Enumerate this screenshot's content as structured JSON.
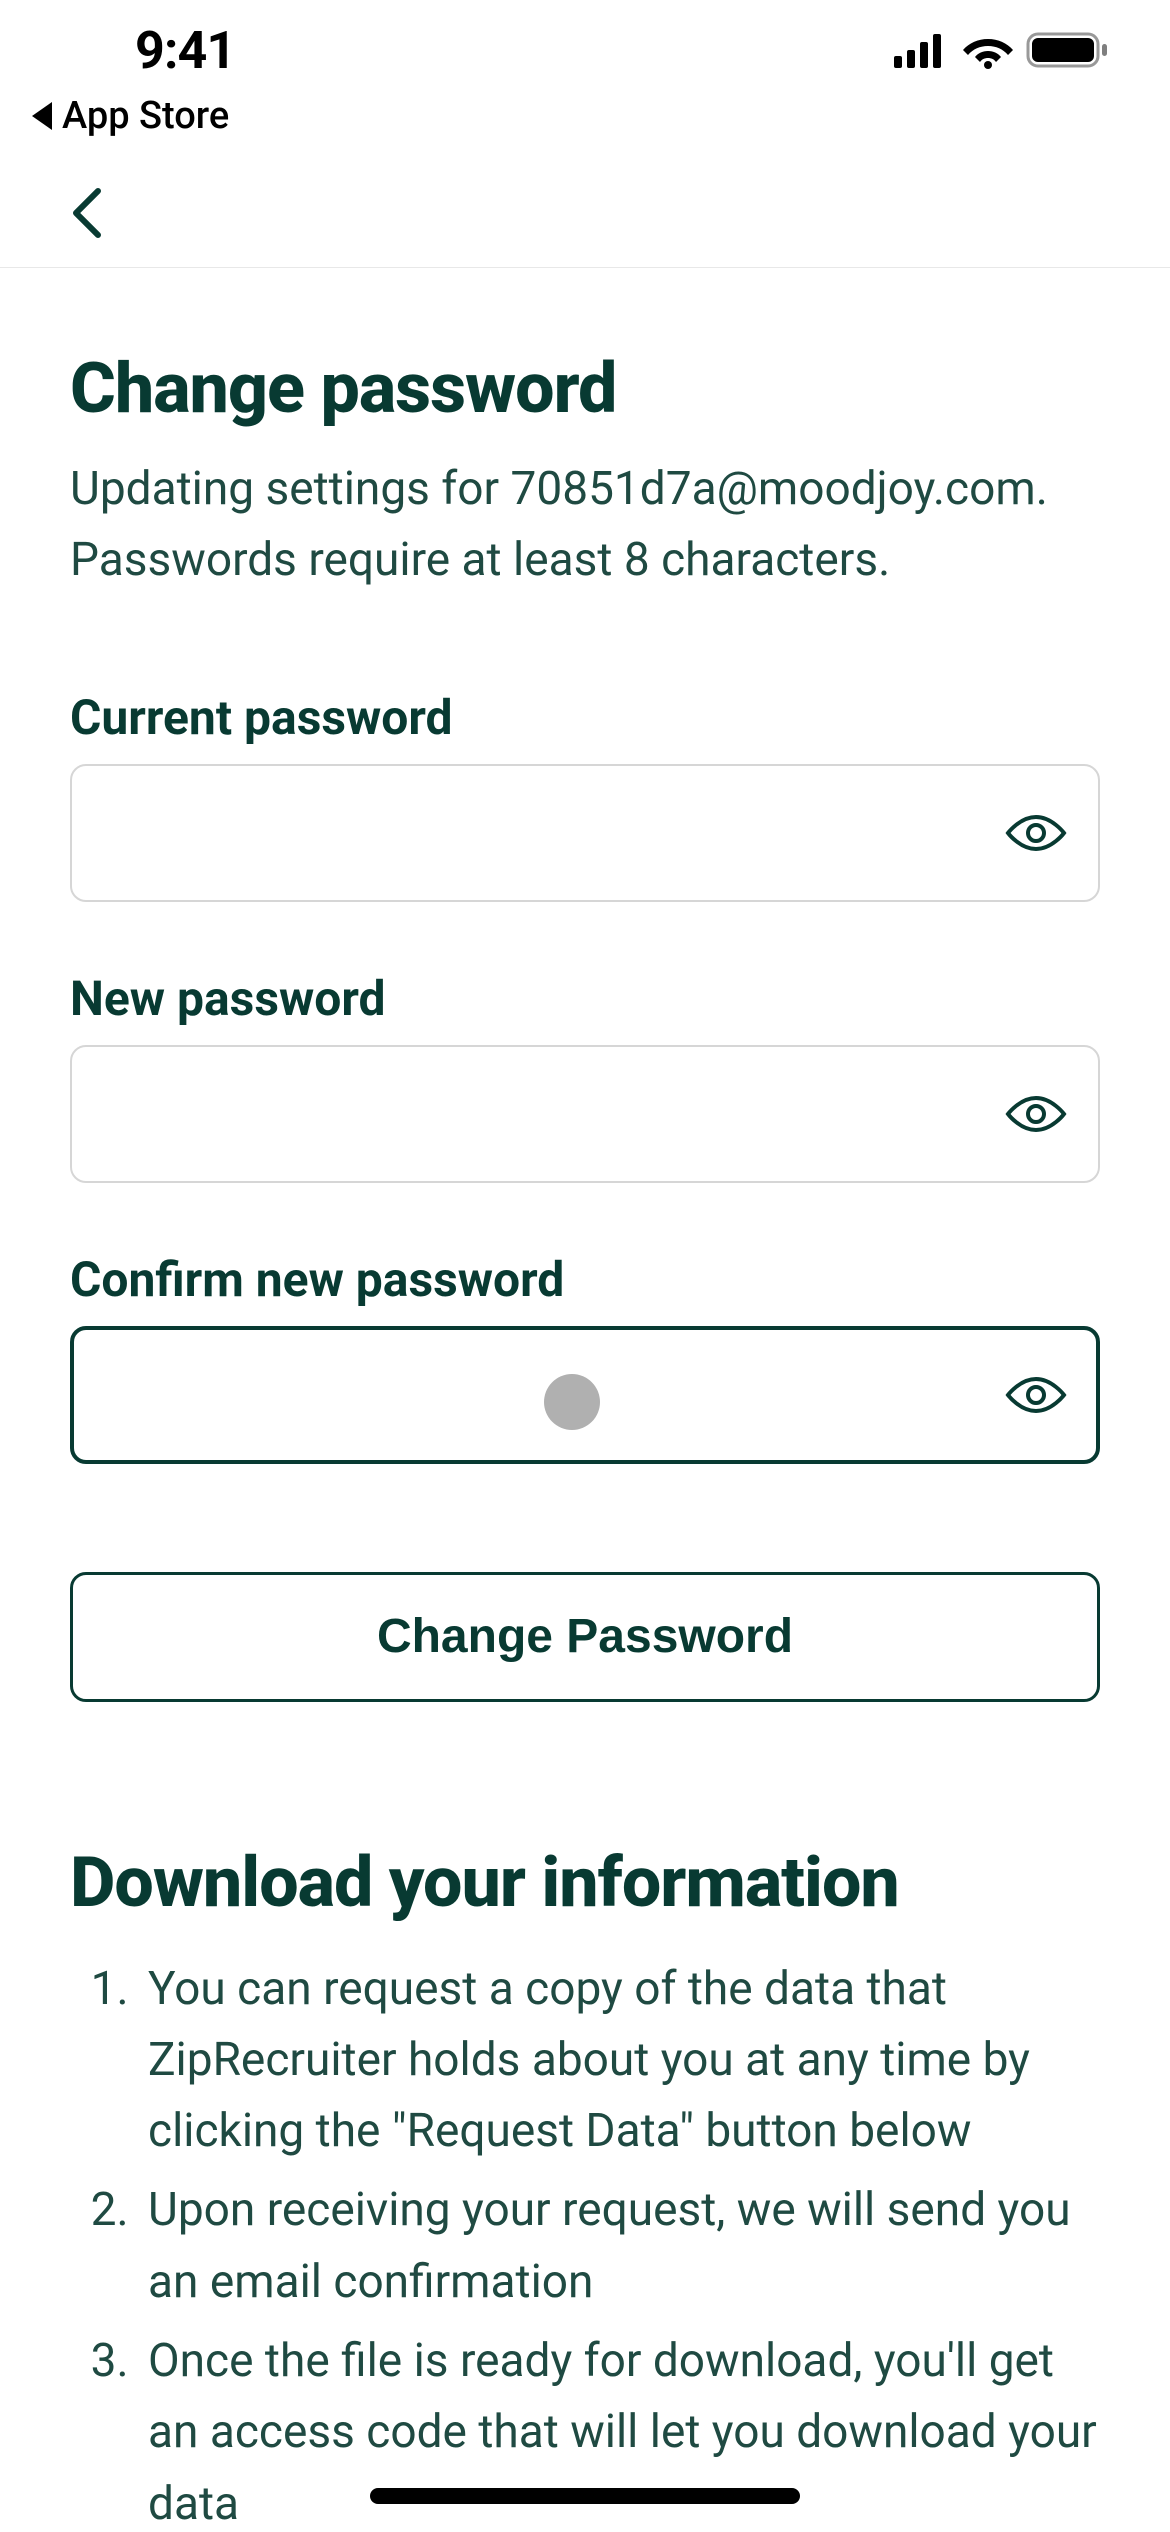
{
  "statusbar": {
    "time": "9:41",
    "back_app_label": "App Store"
  },
  "page": {
    "title": "Change password",
    "subtitle": "Updating settings for 70851d7a@moodjoy.com. Passwords require at least 8 characters."
  },
  "fields": {
    "current": {
      "label": "Current password",
      "value": ""
    },
    "new": {
      "label": "New password",
      "value": ""
    },
    "confirm": {
      "label": "Confirm new password",
      "value": ""
    }
  },
  "buttons": {
    "submit": "Change Password"
  },
  "download": {
    "title": "Download your information",
    "items": [
      "You can request a copy of the data that ZipRecruiter holds about you at any time by clicking the \"Request Data\" button below",
      "Upon receiving your request, we will send you an email confirmation",
      "Once the file is ready for download, you'll get an access code that will let you download your data"
    ]
  }
}
